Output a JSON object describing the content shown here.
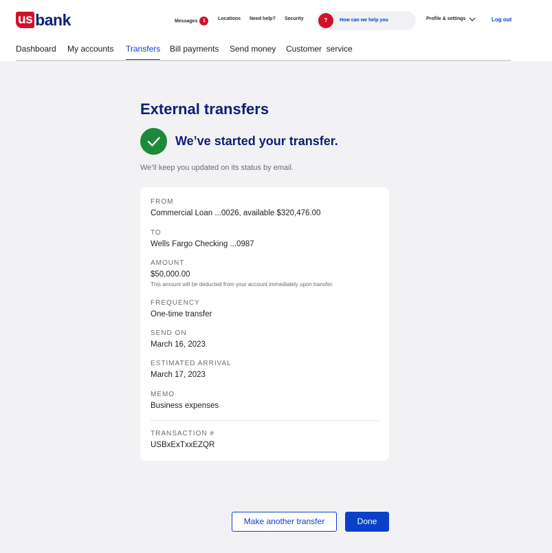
{
  "brand": {
    "logo_mark": "us",
    "logo_word": "bank",
    "primary": "#0c2074",
    "accent": "#d0112b",
    "link": "#0a41c9",
    "success": "#1d8a3a"
  },
  "utility_nav": {
    "messages": "Messages",
    "messages_count": "1",
    "locations": "Locations",
    "need_help": "Need help?",
    "security": "Security",
    "help_search": "How can we help you",
    "help_icon": "?",
    "profile": "Profile & settings",
    "logout": "Log out"
  },
  "main_nav": {
    "items": [
      {
        "label": "Dashboard",
        "active": false
      },
      {
        "label": "My accounts",
        "active": false
      },
      {
        "label": "Transfers",
        "active": true
      },
      {
        "label": "Bill payments",
        "active": false
      },
      {
        "label": "Send money",
        "active": false
      },
      {
        "label": "Customer  service",
        "active": false
      }
    ]
  },
  "page": {
    "title": "External transfers",
    "status_icon": "check-icon",
    "status_title": "We’ve started your transfer.",
    "status_note": "We’ll keep you updated on its status by email."
  },
  "details": {
    "from_label": "FROM",
    "from_value": "Commercial Loan ...0026, available $320,476.00",
    "to_label": "TO",
    "to_value": "Wells Fargo Checking ...0987",
    "amount_label": "AMOUNT",
    "amount_value": "$50,000.00",
    "amount_note": "This amount will be deducted from your account immediately upon transfer.",
    "frequency_label": "FREQUENCY",
    "frequency_value": "One-time transfer",
    "send_on_label": "SEND ON",
    "send_on_value": "March 16, 2023",
    "arrival_label": "ESTIMATED ARRIVAL",
    "arrival_value": "March 17, 2023",
    "memo_label": "MEMO",
    "memo_value": "Business expenses",
    "transaction_label": "TRANSACTION #",
    "transaction_value": "USBxExTxxEZQR"
  },
  "actions": {
    "another": "Make another transfer",
    "done": "Done"
  }
}
